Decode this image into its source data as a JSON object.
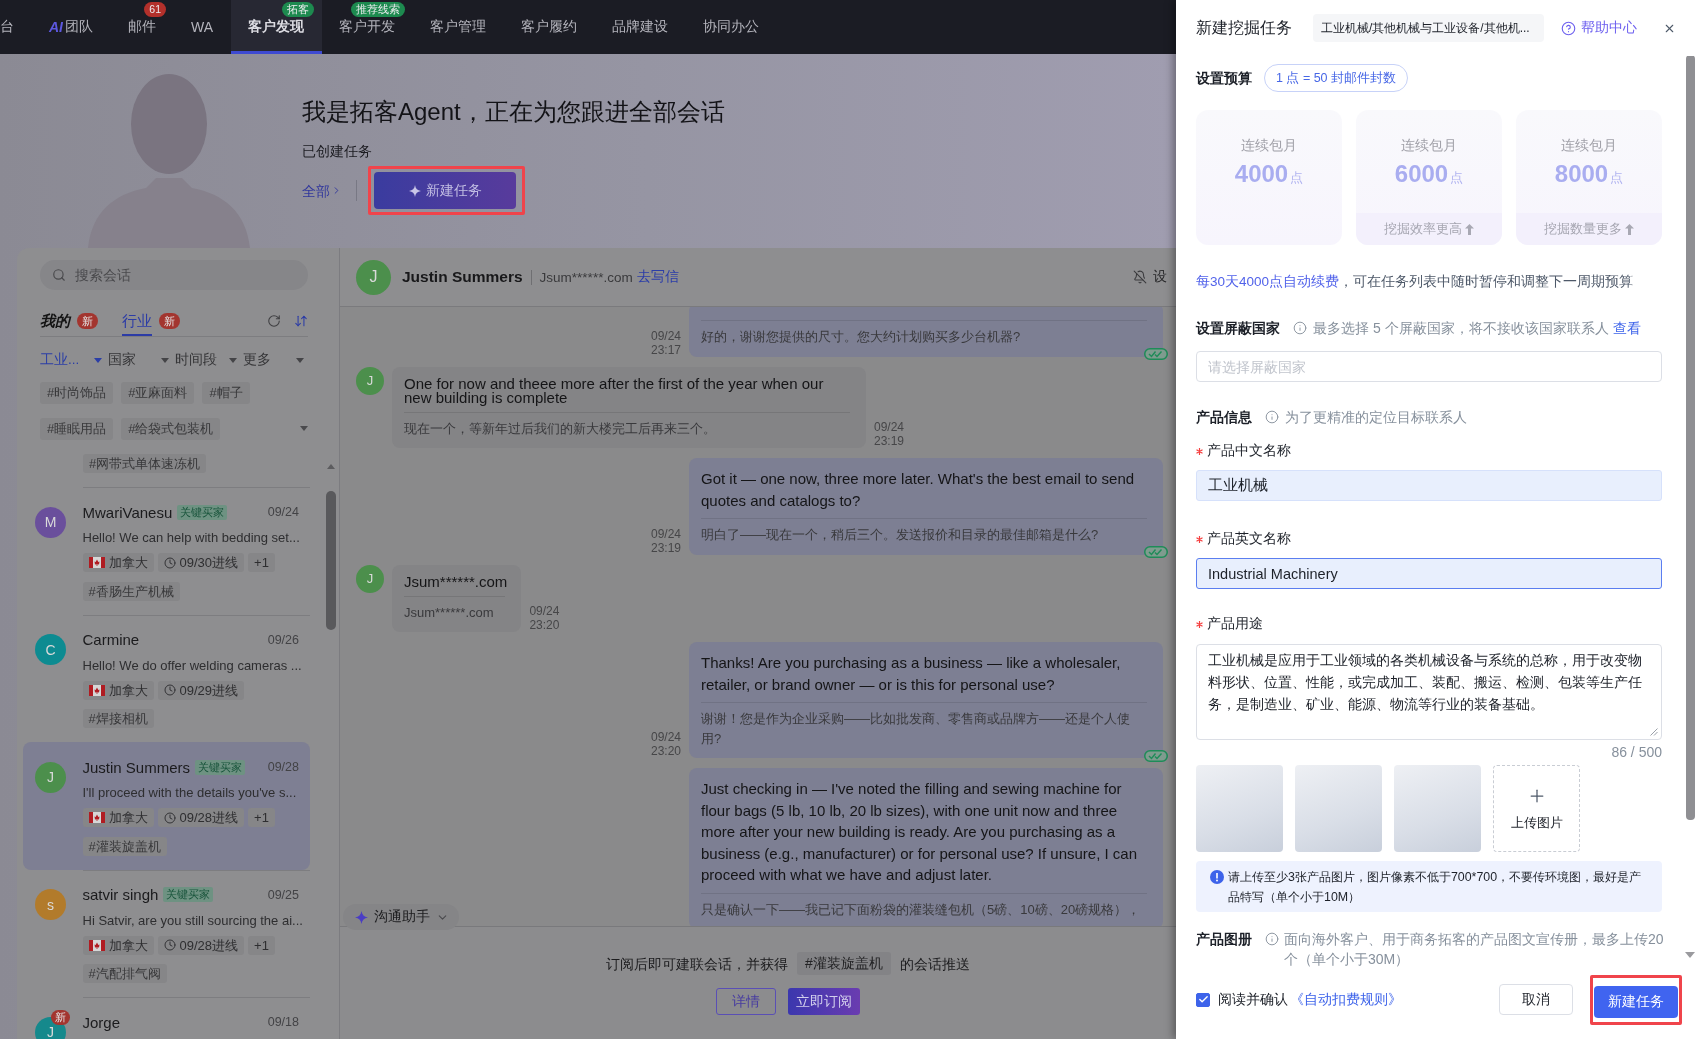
{
  "nav": {
    "items": [
      {
        "label": "台",
        "selected": false
      },
      {
        "logo": "AI",
        "label": "团队",
        "selected": false
      },
      {
        "label": "邮件",
        "badge": {
          "text": "61",
          "kind": "count"
        },
        "selected": false
      },
      {
        "label": "WA",
        "selected": false
      },
      {
        "label": "客户发现",
        "badge": {
          "text": "拓客",
          "kind": "tag"
        },
        "selected": true
      },
      {
        "label": "客户开发",
        "badge": {
          "text": "推荐线索",
          "kind": "tag"
        },
        "selected": false
      },
      {
        "label": "客户管理",
        "selected": false
      },
      {
        "label": "客户履约",
        "selected": false
      },
      {
        "label": "品牌建设",
        "selected": false
      },
      {
        "label": "协同办公",
        "selected": false
      }
    ]
  },
  "agent_header": {
    "title": "我是拓客Agent，正在为您跟进全部会话",
    "subtitle": "已创建任务",
    "all_link": "全部",
    "new_task_button": "新建任务",
    "highlighted": true
  },
  "conversation_panel": {
    "search": {
      "placeholder": "搜索会话"
    },
    "tabs": [
      {
        "label": "我的",
        "badge": "新",
        "selected": false
      },
      {
        "label": "行业",
        "badge": "新",
        "selected": true
      }
    ],
    "filters": [
      {
        "label": "工业...",
        "active": true
      },
      {
        "label": "国家",
        "active": false
      },
      {
        "label": "时间段",
        "active": false
      },
      {
        "label": "更多",
        "active": false
      }
    ],
    "tags": [
      "#时尚饰品",
      "#亚麻面料",
      "#帽子",
      "#睡眠用品",
      "#给袋式包装机"
    ],
    "clipped_item_topic": "#网带式单体速冻机",
    "conversations": [
      {
        "avatar": "M",
        "color": "#6a4f9c",
        "name": "MwariVanesu",
        "label": "关键买家",
        "date": "09/24",
        "preview": "Hello! We can help with bedding set...",
        "country": "加拿大",
        "entered": "09/30进线",
        "extra": "+1",
        "topic": "#香肠生产机械",
        "selected": false
      },
      {
        "avatar": "C",
        "color": "#0d8b91",
        "name": "Carmine",
        "date": "09/26",
        "preview": "Hello! We do offer welding cameras ...",
        "country": "加拿大",
        "entered": "09/29进线",
        "topic": "#焊接相机",
        "selected": false
      },
      {
        "avatar": "J",
        "color": "#4c8f4c",
        "name": "Justin Summers",
        "label": "关键买家",
        "date": "09/28",
        "preview": "I'll proceed with the details you've s...",
        "country": "加拿大",
        "entered": "09/28进线",
        "extra": "+1",
        "topic": "#灌装旋盖机",
        "selected": true
      },
      {
        "avatar": "s",
        "color": "#b27b2b",
        "name": "satvir singh",
        "label": "关键买家",
        "date": "09/25",
        "preview": "Hi Satvir, are you still sourcing the ai...",
        "country": "加拿大",
        "entered": "09/28进线",
        "extra": "+1",
        "topic": "#汽配排气阀",
        "selected": false
      },
      {
        "avatar": "J",
        "color": "#15898c",
        "name": "Jorge",
        "badge": "新",
        "date": "09/18",
        "selected": false
      }
    ]
  },
  "chat": {
    "contact": {
      "avatar": "J",
      "name": "Justin Summers",
      "email": "Jsum******.com",
      "write_link": "去写信",
      "header_action": "设"
    },
    "messages": [
      {
        "kind": "outgoing",
        "translation": "好的，谢谢您提供的尺寸。您大约计划购买多少台机器?",
        "date": "09/24",
        "time": "23:17",
        "read": true
      },
      {
        "kind": "incoming",
        "avatar": "J",
        "text": "One for now and theee more after the first of the year when our new building is complete",
        "translation": "现在一个，等新年过后我们的新大楼完工后再来三个。",
        "date": "09/24",
        "time": "23:19"
      },
      {
        "kind": "outgoing",
        "text": "Got it — one now, three more later. What's the best email to send quotes and catalogs to?",
        "translation": "明白了——现在一个，稍后三个。发送报价和目录的最佳邮箱是什么?",
        "date": "09/24",
        "time": "23:19",
        "read": true
      },
      {
        "kind": "incoming",
        "avatar": "J",
        "text": "Jsum******.com",
        "translation": "Jsum******.com",
        "date": "09/24",
        "time": "23:20"
      },
      {
        "kind": "outgoing",
        "text": "Thanks! Are you purchasing as a business — like a wholesaler, retailer, or brand owner — or is this for personal use?",
        "translation": "谢谢！您是作为企业采购——比如批发商、零售商或品牌方——还是个人使用?",
        "date": "09/24",
        "time": "23:20",
        "read": true
      },
      {
        "kind": "outgoing",
        "text": "Just checking in — I've noted the filling and sewing machine for flour bags (5 lb, 10 lb, 20 lb sizes), with one unit now and three more after your new building is ready. Are you purchasing as a business (e.g., manufacturer) or for personal use? If unsure, I can proceed with what we have and adjust later.",
        "translation": "只是确认一下——我已记下面粉袋的灌装缝包机（5磅、10磅、20磅规格），"
      }
    ],
    "assistant": "沟通助手",
    "subscribe": {
      "text_before": "订阅后即可建联会话，并获得",
      "topic": "#灌装旋盖机",
      "text_after": "的会话推送",
      "details_button": "详情",
      "subscribe_button": "立即订阅"
    }
  },
  "task_drawer": {
    "title": "新建挖掘任务",
    "category": "工业机械/其他机械与工业设备/其他机...",
    "help_link": "帮助中心",
    "budget": {
      "label": "设置预算",
      "rate": "1 点 = 50 封邮件封数",
      "plans": [
        {
          "caption": "连续包月",
          "amount": "4000",
          "unit": "点"
        },
        {
          "caption": "连续包月",
          "amount": "6000",
          "unit": "点",
          "note": "挖掘效率更高"
        },
        {
          "caption": "连续包月",
          "amount": "8000",
          "unit": "点",
          "note": "挖掘数量更多"
        }
      ],
      "renewal_note": {
        "highlight": "每30天4000点自动续费",
        "rest": "，可在任务列表中随时暂停和调整下一周期预算"
      }
    },
    "blocked_countries": {
      "label": "设置屏蔽国家",
      "hint": "最多选择 5 个屏蔽国家，将不接收该国家联系人",
      "view_link": "查看",
      "placeholder": "请选择屏蔽国家"
    },
    "product_info": {
      "label": "产品信息",
      "hint": "为了更精准的定位目标联系人",
      "fields": [
        {
          "label": "产品中文名称",
          "required": true,
          "value": "工业机械",
          "focused": false
        },
        {
          "label": "产品英文名称",
          "required": true,
          "value": "Industrial Machinery",
          "focused": true
        }
      ],
      "usage": {
        "label": "产品用途",
        "required": true,
        "value": "工业机械是应用于工业领域的各类机械设备与系统的总称，用于改变物料形状、位置、性能，或完成加工、装配、搬运、检测、包装等生产任务，是制造业、矿业、能源、物流等行业的装备基础。",
        "counter": "86 / 500"
      },
      "gallery": [
        {
          "kind": "photo"
        },
        {
          "kind": "photo"
        },
        {
          "kind": "photo"
        },
        {
          "kind": "upload",
          "label": "上传图片"
        }
      ],
      "upload_notice": "请上传至少3张产品图片，图片像素不低于700*700，不要传环境图，最好是产品特写（单个小于10M）"
    },
    "brochure": {
      "label": "产品图册",
      "hint": "面向海外客户、用于商务拓客的产品图文宣传册，最多上传20个（单个小于30M）"
    },
    "footer": {
      "agree_checked": true,
      "agree_text": "阅读并确认",
      "rules_link": "《自动扣费规则》",
      "cancel_button": "取消",
      "submit_button": "新建任务",
      "submit_highlighted": true
    }
  }
}
